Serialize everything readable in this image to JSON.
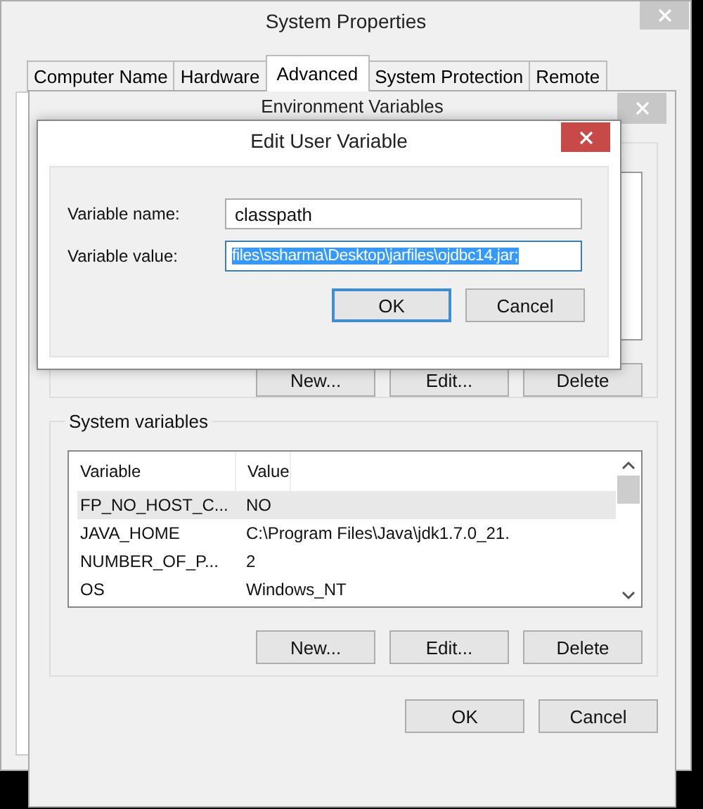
{
  "system_properties": {
    "title": "System Properties",
    "tabs": [
      {
        "label": "Computer Name",
        "selected": false
      },
      {
        "label": "Hardware",
        "selected": false
      },
      {
        "label": "Advanced",
        "selected": true
      },
      {
        "label": "System Protection",
        "selected": false
      },
      {
        "label": "Remote",
        "selected": false
      }
    ]
  },
  "environment_variables": {
    "title": "Environment Variables",
    "user_variables": {
      "buttons": [
        "New...",
        "Edit...",
        "Delete"
      ]
    },
    "system_variables": {
      "label": "System variables",
      "columns": [
        "Variable",
        "Value"
      ],
      "rows": [
        {
          "variable": "FP_NO_HOST_C...",
          "value": "NO",
          "selected": true
        },
        {
          "variable": "JAVA_HOME",
          "value": "C:\\Program Files\\Java\\jdk1.7.0_21.",
          "selected": false
        },
        {
          "variable": "NUMBER_OF_P...",
          "value": "2",
          "selected": false
        },
        {
          "variable": "OS",
          "value": "Windows_NT",
          "selected": false
        }
      ],
      "buttons": [
        "New...",
        "Edit...",
        "Delete"
      ]
    },
    "buttons": [
      "OK",
      "Cancel"
    ]
  },
  "edit_dialog": {
    "title": "Edit User Variable",
    "fields": [
      {
        "label": "Variable name:",
        "value": "classpath",
        "selected": false
      },
      {
        "label": "Variable value:",
        "value": "files\\ssharma\\Desktop\\jarfiles\\ojdbc14.jar;",
        "selected": true
      }
    ],
    "buttons": [
      {
        "label": "OK",
        "default": true
      },
      {
        "label": "Cancel",
        "default": false
      }
    ]
  }
}
